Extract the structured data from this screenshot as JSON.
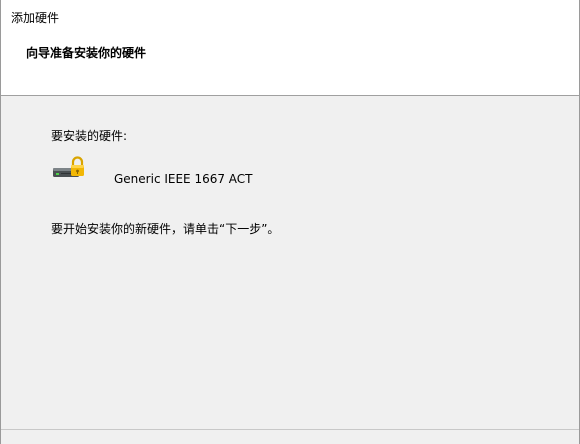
{
  "window": {
    "title": "添加硬件"
  },
  "header": {
    "heading": "向导准备安装你的硬件"
  },
  "content": {
    "hardware_to_install_label": "要安装的硬件:",
    "device_name": "Generic IEEE 1667 ACT",
    "device_icon": "storage-lock-icon",
    "instruction": "要开始安装你的新硬件，请单击“下一步”。"
  },
  "colors": {
    "background": "#f0f0f0",
    "header_background": "#ffffff",
    "divider": "#a0a0a0",
    "lock_gold": "#f2b705"
  }
}
